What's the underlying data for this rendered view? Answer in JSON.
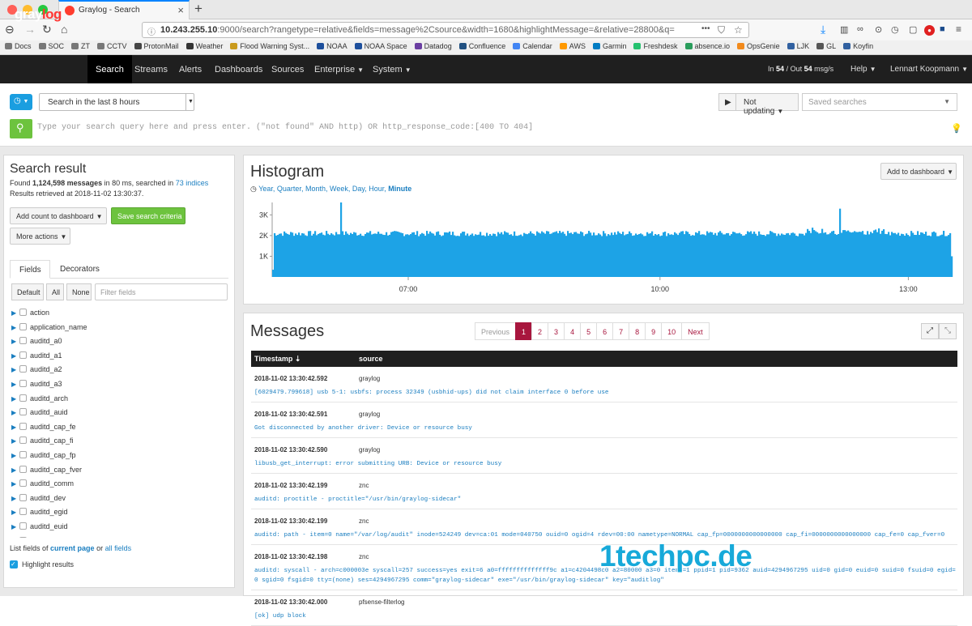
{
  "browser": {
    "tab_title": "Graylog - Search",
    "new_tab": "+",
    "url_host": "10.243.255.10",
    "url_rest": ":9000/search?rangetype=relative&fields=message%2Csource&width=1680&highlightMessage=&relative=28800&q=",
    "more": "•••",
    "bookmarks": [
      {
        "label": "Docs",
        "color": "#777"
      },
      {
        "label": "SOC",
        "color": "#777"
      },
      {
        "label": "ZT",
        "color": "#777"
      },
      {
        "label": "CCTV",
        "color": "#777"
      },
      {
        "label": "ProtonMail",
        "color": "#444"
      },
      {
        "label": "Weather",
        "color": "#333"
      },
      {
        "label": "Flood Warning Syst...",
        "color": "#c99a1c"
      },
      {
        "label": "NOAA",
        "color": "#1d4f9c"
      },
      {
        "label": "NOAA Space",
        "color": "#1d4f9c"
      },
      {
        "label": "Datadog",
        "color": "#6a3ea1"
      },
      {
        "label": "Confluence",
        "color": "#205081"
      },
      {
        "label": "Calendar",
        "color": "#4285f4"
      },
      {
        "label": "AWS",
        "color": "#ff9900"
      },
      {
        "label": "Garmin",
        "color": "#007cc3"
      },
      {
        "label": "Freshdesk",
        "color": "#25c16f"
      },
      {
        "label": "absence.io",
        "color": "#2a9d5c"
      },
      {
        "label": "OpsGenie",
        "color": "#f28a1c"
      },
      {
        "label": "LJK",
        "color": "#3060a0"
      },
      {
        "label": "GL",
        "color": "#555"
      },
      {
        "label": "Koyfin",
        "color": "#3060a0"
      }
    ]
  },
  "nav": {
    "logo_a": "gray",
    "logo_b": "log",
    "items": [
      {
        "label": "Search",
        "name": "nav-search",
        "active": true
      },
      {
        "label": "Streams",
        "name": "nav-streams"
      },
      {
        "label": "Alerts",
        "name": "nav-alerts"
      },
      {
        "label": "Dashboards",
        "name": "nav-dashboards"
      },
      {
        "label": "Sources",
        "name": "nav-sources"
      },
      {
        "label": "Enterprise",
        "name": "nav-enterprise",
        "caret": true
      },
      {
        "label": "System",
        "name": "nav-system",
        "caret": true
      }
    ],
    "throughput_in_label": "In",
    "throughput_in": "54",
    "throughput_out_label": "/ Out",
    "throughput_out": "54",
    "throughput_unit": "msg/s",
    "help": "Help",
    "user": "Lennart Koopmann"
  },
  "search": {
    "range": "Search in the last 8 hours",
    "updating": "Not updating",
    "saved_placeholder": "Saved searches",
    "query_placeholder": "Type your search query here and press enter. (\"not found\" AND http) OR http_response_code:[400 TO 404]"
  },
  "result": {
    "title": "Search result",
    "found_prefix": "Found",
    "count": "1,124,598 messages",
    "found_mid": "in 80 ms, searched in",
    "indices": "73 indices",
    "retrieved": "Results retrieved at 2018-11-02 13:30:37.",
    "add_count": "Add count to dashboard",
    "save_criteria": "Save search criteria",
    "more_actions": "More actions",
    "tab_fields": "Fields",
    "tab_decorators": "Decorators",
    "filter_default": "Default",
    "filter_all": "All",
    "filter_none": "None",
    "filter_placeholder": "Filter fields",
    "fields": [
      "action",
      "application_name",
      "auditd_a0",
      "auditd_a1",
      "auditd_a2",
      "auditd_a3",
      "auditd_arch",
      "auditd_auid",
      "auditd_cap_fe",
      "auditd_cap_fi",
      "auditd_cap_fp",
      "auditd_cap_fver",
      "auditd_comm",
      "auditd_dev",
      "auditd_egid",
      "auditd_euid",
      "auditd_exe"
    ],
    "list_prefix": "List fields of",
    "current_page": "current page",
    "list_or": "or",
    "all_fields": "all fields",
    "highlight": "Highlight results"
  },
  "histogram": {
    "title": "Histogram",
    "add_to_dashboard": "Add to dashboard",
    "resolutions": [
      "Year",
      "Quarter",
      "Month",
      "Week",
      "Day",
      "Hour",
      "Minute"
    ],
    "active_resolution": "Minute"
  },
  "chart_data": {
    "type": "bar",
    "x_ticks": [
      "07:00",
      "10:00",
      "13:00"
    ],
    "y_ticks": [
      "1K",
      "2K",
      "3K"
    ],
    "ylim": [
      0,
      3600
    ],
    "series_color": "#1da3e6",
    "baseline": 2100,
    "spikes": [
      {
        "position": 0.1,
        "value": 3600
      },
      {
        "position": 0.835,
        "value": 3300
      }
    ],
    "end_values": [
      {
        "position": 0.0,
        "value": 350
      },
      {
        "position": 1.0,
        "value": 1000
      }
    ]
  },
  "messages": {
    "title": "Messages",
    "pages": [
      "Previous",
      "1",
      "2",
      "3",
      "4",
      "5",
      "6",
      "7",
      "8",
      "9",
      "10",
      "Next"
    ],
    "active_page": "1",
    "col_timestamp": "Timestamp",
    "col_source": "source",
    "rows": [
      {
        "ts": "2018-11-02 13:30:42.592",
        "src": "graylog",
        "msg": "[6029479.799618] usb 5-1: usbfs: process 32349 (usbhid-ups) did not claim interface 0 before use"
      },
      {
        "ts": "2018-11-02 13:30:42.591",
        "src": "graylog",
        "msg": "Got disconnected by another driver: Device or resource busy"
      },
      {
        "ts": "2018-11-02 13:30:42.590",
        "src": "graylog",
        "msg": "libusb_get_interrupt: error submitting URB: Device or resource busy"
      },
      {
        "ts": "2018-11-02 13:30:42.199",
        "src": "znc",
        "msg": "auditd: proctitle - proctitle=\"/usr/bin/graylog-sidecar\""
      },
      {
        "ts": "2018-11-02 13:30:42.199",
        "src": "znc",
        "msg": "auditd: path - item=0 name=\"/var/log/audit\" inode=524249 dev=ca:01 mode=040750 ouid=0 ogid=4 rdev=00:00 nametype=NORMAL cap_fp=0000000000000000 cap_fi=0000000000000000 cap_fe=0 cap_fver=0"
      },
      {
        "ts": "2018-11-02 13:30:42.198",
        "src": "znc",
        "msg": "auditd: syscall - arch=c000003e syscall=257 success=yes exit=6 a0=ffffffffffffff9c a1=c4204498c0 a2=80000 a3=0 items=1 ppid=1 pid=9362 auid=4294967295 uid=0 gid=0 euid=0 suid=0 fsuid=0 egid=0 sgid=0 fsgid=0 tty=(none) ses=4294967295 comm=\"graylog-sidecar\" exe=\"/usr/bin/graylog-sidecar\" key=\"auditlog\""
      },
      {
        "ts": "2018-11-02 13:30:42.000",
        "src": "pfsense-filterlog",
        "msg": "[ok] udp block"
      }
    ]
  },
  "watermark": "1techpc.de"
}
